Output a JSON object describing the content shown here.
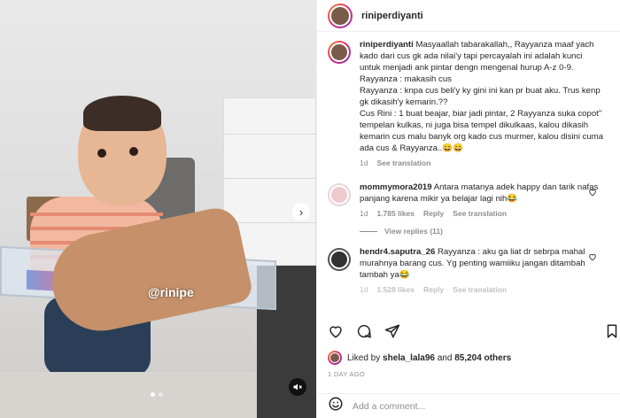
{
  "post": {
    "username": "riniperdiyanti",
    "media": {
      "watermark": "@rinipe",
      "carousel_active_index": 0,
      "carousel_count": 2
    },
    "caption": {
      "username": "riniperdiyanti",
      "lines": [
        "Masyaallah tabarakallah,, Rayyanza maaf yach",
        "kado dari cus gk ada nilai'y tapi percayalah ini adalah kunci",
        "untuk menjadi ank pintar dengn mengenal hurup A-z 0-9.",
        "Rayyanza : makasih cus",
        "Rayyanza : knpa cus beli'y ky gini ini kan pr buat aku. Trus kenp",
        "gk dikasih'y kemarin.??",
        "Cus Rini : 1 buat beajar, biar jadi pintar, 2 Rayyanza suka copot\"",
        "tempelan kulkas, ni juga bisa tempel dikulkaas, kalou dikasih",
        "kemarin cus malu banyk org kado cus murmer, kalou disini cuma",
        "ada cus & Rayyanza..😄😄"
      ],
      "time": "1d",
      "translate": "See translation"
    },
    "comments": [
      {
        "username": "mommymora2019",
        "lines": [
          "Antara matanya adek happy dan tarik nafas",
          "panjang karena mikir ya belajar lagi nih😂"
        ],
        "time": "1d",
        "likes": "1.785 likes",
        "reply": "Reply",
        "translate": "See translation",
        "view_replies": "View replies (11)"
      },
      {
        "username": "hendr4.saputra_26",
        "lines": [
          "Rayyanza : aku ga liat dr sebrpa mahal",
          "murahnya barang cus. Yg penting wamiiku jangan ditambah",
          "tambah ya😂"
        ],
        "time": "1d",
        "likes": "1.528 likes",
        "reply": "Reply",
        "translate": "See translation"
      }
    ],
    "likes": {
      "prefix": "Liked by",
      "user": "shela_lala96",
      "and": "and",
      "others": "85,204 others"
    },
    "date": "1 DAY AGO",
    "comment_input": {
      "placeholder": "Add a comment..."
    }
  },
  "colors": {
    "text": "#262626",
    "muted": "#8e8e8e",
    "border": "#efefef"
  }
}
